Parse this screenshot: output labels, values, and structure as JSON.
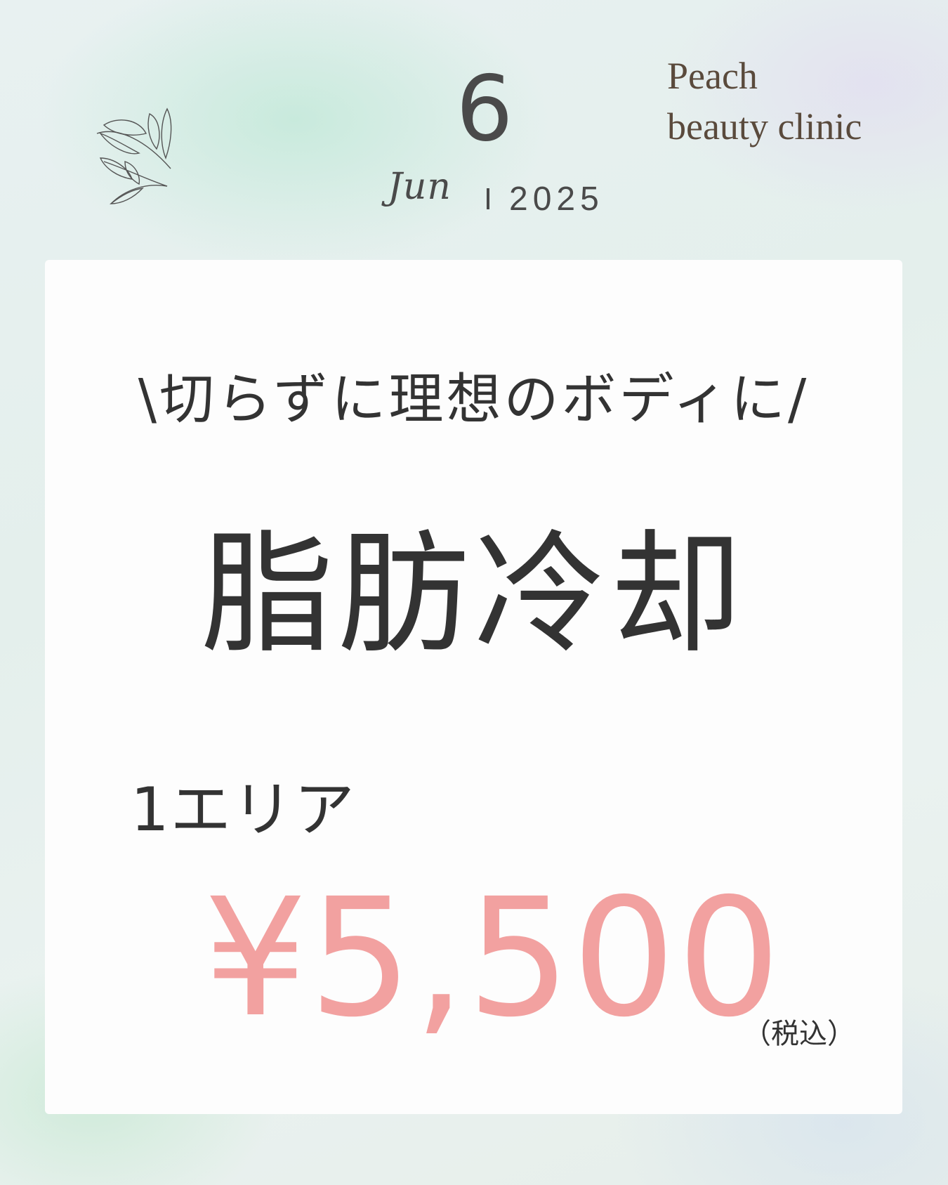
{
  "header": {
    "day": "6",
    "month": "Jun",
    "year": "2025",
    "brand_line1": "Peach",
    "brand_line2": "beauty clinic"
  },
  "card": {
    "tagline": "\\切らずに理想のボディに/",
    "service": "脂肪冷却",
    "area": "1エリア",
    "price": "¥5,500",
    "tax_note": "（税込）"
  },
  "colors": {
    "price": "#f2a1a0",
    "text": "#333333",
    "brand": "#5a4a3c"
  },
  "icons": {
    "leaf": "leaf-branch-icon"
  }
}
